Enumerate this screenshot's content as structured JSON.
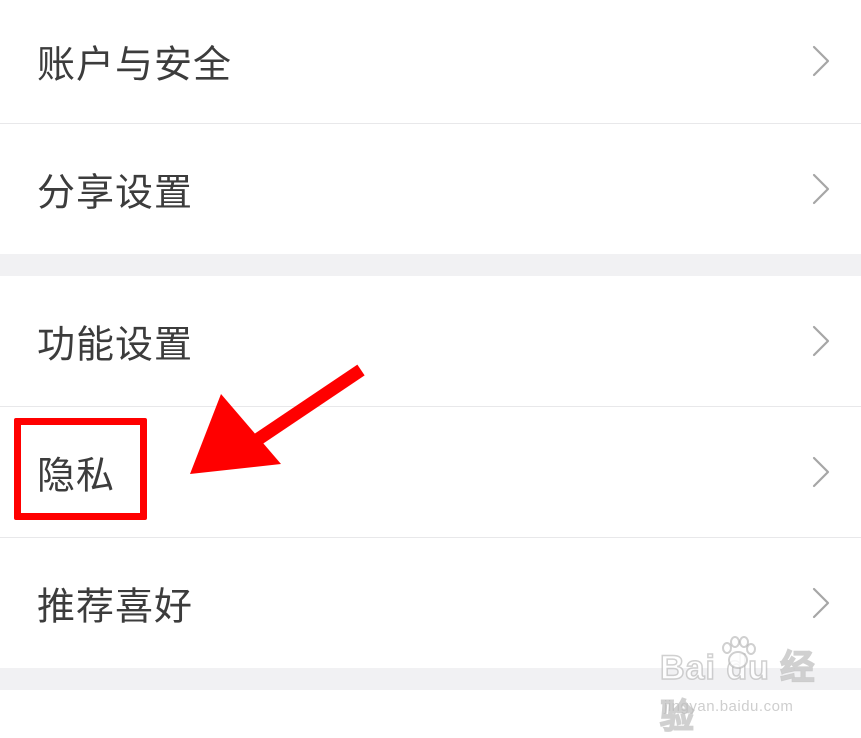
{
  "settings": {
    "items": [
      {
        "label": "账户与安全"
      },
      {
        "label": "分享设置"
      },
      {
        "label": "功能设置"
      },
      {
        "label": "隐私"
      },
      {
        "label": "推荐喜好"
      }
    ]
  },
  "annotation": {
    "highlight_color": "#ff0000",
    "arrow_color": "#ff0000",
    "arrow_icon": "arrow-pointing-left-down-icon"
  },
  "watermark": {
    "brand": "Bai du 经验",
    "url": "jingyan.baidu.com"
  },
  "icons": {
    "row_chevron": "chevron-right-icon"
  },
  "colors": {
    "text": "#3c3c3c",
    "chevron": "#a6a6a6",
    "group_gap": "#f1f1f3",
    "divider": "#e8e8ea"
  }
}
